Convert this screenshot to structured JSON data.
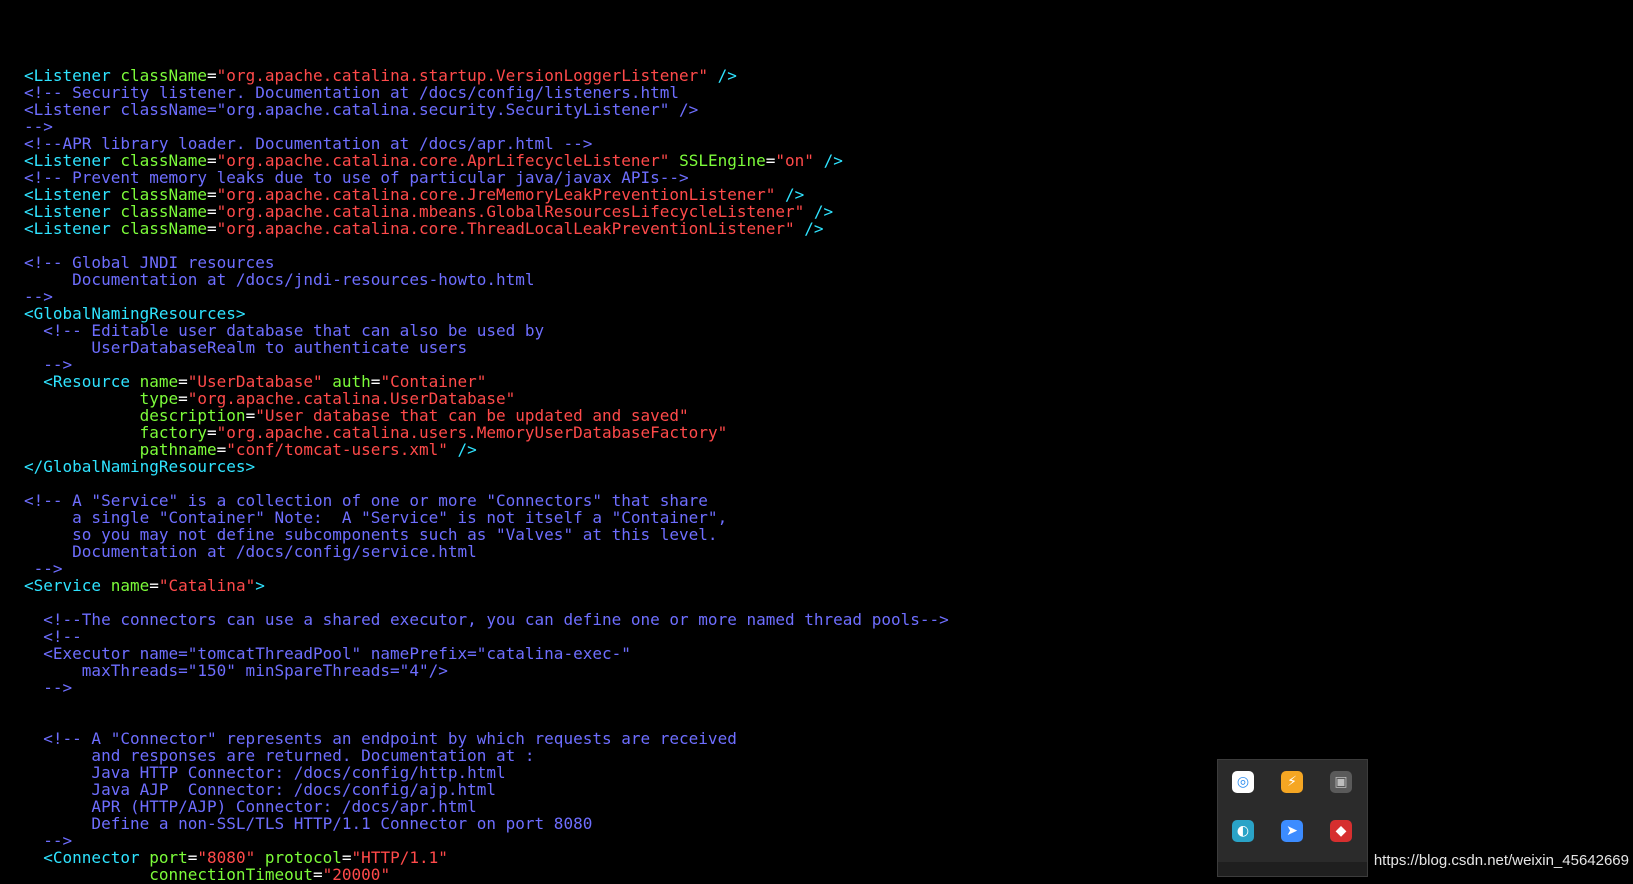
{
  "code_lines": [
    [],
    [
      {
        "c": "tag",
        "t": "<Listener "
      },
      {
        "c": "attr",
        "t": "className"
      },
      {
        "c": "eq",
        "t": "="
      },
      {
        "c": "val",
        "t": "\"org.apache.catalina.startup.VersionLoggerListener\""
      },
      {
        "c": "tag",
        "t": " />"
      }
    ],
    [
      {
        "c": "comment",
        "t": "<!-- Security listener. Documentation at /docs/config/listeners.html"
      }
    ],
    [
      {
        "c": "comment",
        "t": "<Listener className=\"org.apache.catalina.security.SecurityListener\" />"
      }
    ],
    [
      {
        "c": "comment",
        "t": "-->"
      }
    ],
    [
      {
        "c": "comment",
        "t": "<!--APR library loader. Documentation at /docs/apr.html -->"
      }
    ],
    [
      {
        "c": "tag",
        "t": "<Listener "
      },
      {
        "c": "attr",
        "t": "className"
      },
      {
        "c": "eq",
        "t": "="
      },
      {
        "c": "val",
        "t": "\"org.apache.catalina.core.AprLifecycleListener\""
      },
      {
        "c": "tag",
        "t": " "
      },
      {
        "c": "attr",
        "t": "SSLEngine"
      },
      {
        "c": "eq",
        "t": "="
      },
      {
        "c": "val",
        "t": "\"on\""
      },
      {
        "c": "tag",
        "t": " />"
      }
    ],
    [
      {
        "c": "comment",
        "t": "<!-- Prevent memory leaks due to use of particular java/javax APIs-->"
      }
    ],
    [
      {
        "c": "tag",
        "t": "<Listener "
      },
      {
        "c": "attr",
        "t": "className"
      },
      {
        "c": "eq",
        "t": "="
      },
      {
        "c": "val",
        "t": "\"org.apache.catalina.core.JreMemoryLeakPreventionListener\""
      },
      {
        "c": "tag",
        "t": " />"
      }
    ],
    [
      {
        "c": "tag",
        "t": "<Listener "
      },
      {
        "c": "attr",
        "t": "className"
      },
      {
        "c": "eq",
        "t": "="
      },
      {
        "c": "val",
        "t": "\"org.apache.catalina.mbeans.GlobalResourcesLifecycleListener\""
      },
      {
        "c": "tag",
        "t": " />"
      }
    ],
    [
      {
        "c": "tag",
        "t": "<Listener "
      },
      {
        "c": "attr",
        "t": "className"
      },
      {
        "c": "eq",
        "t": "="
      },
      {
        "c": "val",
        "t": "\"org.apache.catalina.core.ThreadLocalLeakPreventionListener\""
      },
      {
        "c": "tag",
        "t": " />"
      }
    ],
    [],
    [
      {
        "c": "comment",
        "t": "<!-- Global JNDI resources"
      }
    ],
    [
      {
        "c": "comment",
        "t": "     Documentation at /docs/jndi-resources-howto.html"
      }
    ],
    [
      {
        "c": "comment",
        "t": "-->"
      }
    ],
    [
      {
        "c": "tag",
        "t": "<GlobalNamingResources>"
      }
    ],
    [
      {
        "c": "comment",
        "t": "  <!-- Editable user database that can also be used by"
      }
    ],
    [
      {
        "c": "comment",
        "t": "       UserDatabaseRealm to authenticate users"
      }
    ],
    [
      {
        "c": "comment",
        "t": "  -->"
      }
    ],
    [
      {
        "c": "tag",
        "t": "  <Resource "
      },
      {
        "c": "attr",
        "t": "name"
      },
      {
        "c": "eq",
        "t": "="
      },
      {
        "c": "val",
        "t": "\"UserDatabase\""
      },
      {
        "c": "tag",
        "t": " "
      },
      {
        "c": "attr",
        "t": "auth"
      },
      {
        "c": "eq",
        "t": "="
      },
      {
        "c": "val",
        "t": "\"Container\""
      }
    ],
    [
      {
        "c": "tag",
        "t": "            "
      },
      {
        "c": "attr",
        "t": "type"
      },
      {
        "c": "eq",
        "t": "="
      },
      {
        "c": "val",
        "t": "\"org.apache.catalina.UserDatabase\""
      }
    ],
    [
      {
        "c": "tag",
        "t": "            "
      },
      {
        "c": "attr",
        "t": "description"
      },
      {
        "c": "eq",
        "t": "="
      },
      {
        "c": "val",
        "t": "\"User database that can be updated and saved\""
      }
    ],
    [
      {
        "c": "tag",
        "t": "            "
      },
      {
        "c": "attr",
        "t": "factory"
      },
      {
        "c": "eq",
        "t": "="
      },
      {
        "c": "val",
        "t": "\"org.apache.catalina.users.MemoryUserDatabaseFactory\""
      }
    ],
    [
      {
        "c": "tag",
        "t": "            "
      },
      {
        "c": "attr",
        "t": "pathname"
      },
      {
        "c": "eq",
        "t": "="
      },
      {
        "c": "val",
        "t": "\"conf/tomcat-users.xml\""
      },
      {
        "c": "tag",
        "t": " />"
      }
    ],
    [
      {
        "c": "tag",
        "t": "</GlobalNamingResources>"
      }
    ],
    [],
    [
      {
        "c": "comment",
        "t": "<!-- A \"Service\" is a collection of one or more \"Connectors\" that share"
      }
    ],
    [
      {
        "c": "comment",
        "t": "     a single \"Container\" Note:  A \"Service\" is not itself a \"Container\","
      }
    ],
    [
      {
        "c": "comment",
        "t": "     so you may not define subcomponents such as \"Valves\" at this level."
      }
    ],
    [
      {
        "c": "comment",
        "t": "     Documentation at /docs/config/service.html"
      }
    ],
    [
      {
        "c": "comment",
        "t": " -->"
      }
    ],
    [
      {
        "c": "tag",
        "t": "<Service "
      },
      {
        "c": "attr",
        "t": "name"
      },
      {
        "c": "eq",
        "t": "="
      },
      {
        "c": "val",
        "t": "\"Catalina\""
      },
      {
        "c": "tag",
        "t": ">"
      }
    ],
    [],
    [
      {
        "c": "comment",
        "t": "  <!--The connectors can use a shared executor, you can define one or more named thread pools-->"
      }
    ],
    [
      {
        "c": "comment",
        "t": "  <!--"
      }
    ],
    [
      {
        "c": "comment",
        "t": "  <Executor name=\"tomcatThreadPool\" namePrefix=\"catalina-exec-\""
      }
    ],
    [
      {
        "c": "comment",
        "t": "      maxThreads=\"150\" minSpareThreads=\"4\"/>"
      }
    ],
    [
      {
        "c": "comment",
        "t": "  -->"
      }
    ],
    [],
    [],
    [
      {
        "c": "comment",
        "t": "  <!-- A \"Connector\" represents an endpoint by which requests are received"
      }
    ],
    [
      {
        "c": "comment",
        "t": "       and responses are returned. Documentation at :"
      }
    ],
    [
      {
        "c": "comment",
        "t": "       Java HTTP Connector: /docs/config/http.html"
      }
    ],
    [
      {
        "c": "comment",
        "t": "       Java AJP  Connector: /docs/config/ajp.html"
      }
    ],
    [
      {
        "c": "comment",
        "t": "       APR (HTTP/AJP) Connector: /docs/apr.html"
      }
    ],
    [
      {
        "c": "comment",
        "t": "       Define a non-SSL/TLS HTTP/1.1 Connector on port 8080"
      }
    ],
    [
      {
        "c": "comment",
        "t": "  -->"
      }
    ],
    [
      {
        "c": "tag",
        "t": "  <Connector "
      },
      {
        "c": "attr",
        "t": "port"
      },
      {
        "c": "eq",
        "t": "="
      },
      {
        "c": "val",
        "t": "\"8080\""
      },
      {
        "c": "tag",
        "t": " "
      },
      {
        "c": "attr",
        "t": "protocol"
      },
      {
        "c": "eq",
        "t": "="
      },
      {
        "c": "val",
        "t": "\"HTTP/1.1\""
      }
    ],
    [
      {
        "c": "tag",
        "t": "             "
      },
      {
        "c": "attr",
        "t": "connectionTimeout"
      },
      {
        "c": "eq",
        "t": "="
      },
      {
        "c": "val",
        "t": "\"20000\""
      }
    ]
  ],
  "tray": {
    "icons": [
      {
        "name": "baidu-netdisk-icon",
        "glyph": "◎",
        "bg": "#ffffff",
        "fg": "#2a8cf0"
      },
      {
        "name": "security-shield-icon",
        "glyph": "⚡",
        "bg": "#f5a623",
        "fg": "#ffffff"
      },
      {
        "name": "network-device-icon",
        "glyph": "▣",
        "bg": "#5a5a5a",
        "fg": "#bdbdbd"
      },
      {
        "name": "meeting-app-icon",
        "glyph": "◐",
        "bg": "#2aa3c7",
        "fg": "#ffffff"
      },
      {
        "name": "feishu-icon",
        "glyph": "➤",
        "bg": "#3c8cff",
        "fg": "#ffffff"
      },
      {
        "name": "antivirus-icon",
        "glyph": "◆",
        "bg": "#d62f2f",
        "fg": "#ffffff"
      }
    ]
  },
  "watermark": "https://blog.csdn.net/weixin_45642669",
  "colors": {
    "background": "#000000",
    "tag": "#2fe3ff",
    "attribute": "#7cfc3a",
    "value": "#ff4a4a",
    "comment": "#6e6eff"
  }
}
